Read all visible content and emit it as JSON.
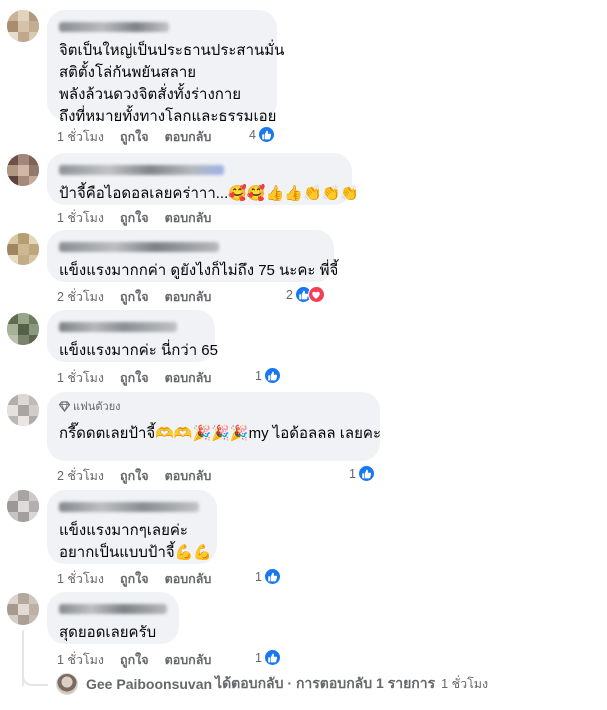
{
  "comments": [
    {
      "lines": [
        "จิตเป็นใหญ่เป็นประธานประสานมั่น",
        "สติตั้งโล่กันพยันสลาย",
        "พลังล้วนดวงจิตสั่งทั้งร่างกาย",
        "ถึงที่หมายทั้งทางโลกและธรรมเอย"
      ],
      "time": "1 ชั่วโมง",
      "like_label": "ถูกใจ",
      "reply_label": "ตอบกลับ",
      "reaction_count": "4"
    },
    {
      "lines": [
        "ป้าจี้คือไอดอลเลยคร่าาา...🥰🥰👍👍👏👏👏"
      ],
      "time": "1 ชั่วโมง",
      "like_label": "ถูกใจ",
      "reply_label": "ตอบกลับ",
      "reaction_count": ""
    },
    {
      "lines": [
        "แข็งแรงมากกค่า ดูยังไงก็ไม่ถึง 75 นะคะ พี่จี้"
      ],
      "time": "2 ชั่วโมง",
      "like_label": "ถูกใจ",
      "reply_label": "ตอบกลับ",
      "reaction_count": "2"
    },
    {
      "lines": [
        "แข็งแรงมากค่ะ นี่กว่า 65"
      ],
      "time": "1 ชั่วโมง",
      "like_label": "ถูกใจ",
      "reply_label": "ตอบกลับ",
      "reaction_count": "1"
    },
    {
      "badge": "แฟนตัวยง",
      "lines": [
        "กรี๊ดดตเลยป้าจี้🫶🫶🎉🎉🎉my ไอด้อลลล เลยคะ"
      ],
      "time": "2 ชั่วโมง",
      "like_label": "ถูกใจ",
      "reply_label": "ตอบกลับ",
      "reaction_count": "1"
    },
    {
      "lines": [
        "แข็งแรงมากๆเลยค่ะ",
        "อยากเป็นแบบป้าจี้💪💪"
      ],
      "time": "1 ชั่วโมง",
      "like_label": "ถูกใจ",
      "reply_label": "ตอบกลับ",
      "reaction_count": "1"
    },
    {
      "lines": [
        "สุดยอดเลยครับ"
      ],
      "time": "1 ชั่วโมง",
      "like_label": "ถูกใจ",
      "reply_label": "ตอบกลับ",
      "reaction_count": "1"
    }
  ],
  "reply_summary": {
    "author": "Gee Paiboonsuvan",
    "text": "ได้ตอบกลับ · การตอบกลับ 1 รายการ",
    "time": "1 ชั่วโมง"
  },
  "icons": {
    "like": "like-icon",
    "love": "heart-icon",
    "fan_badge": "diamond-icon"
  },
  "colors": {
    "like_blue": "#1877f2",
    "love_red": "#f33e58",
    "bubble_bg": "#f0f2f5",
    "meta_gray": "#65676b"
  }
}
